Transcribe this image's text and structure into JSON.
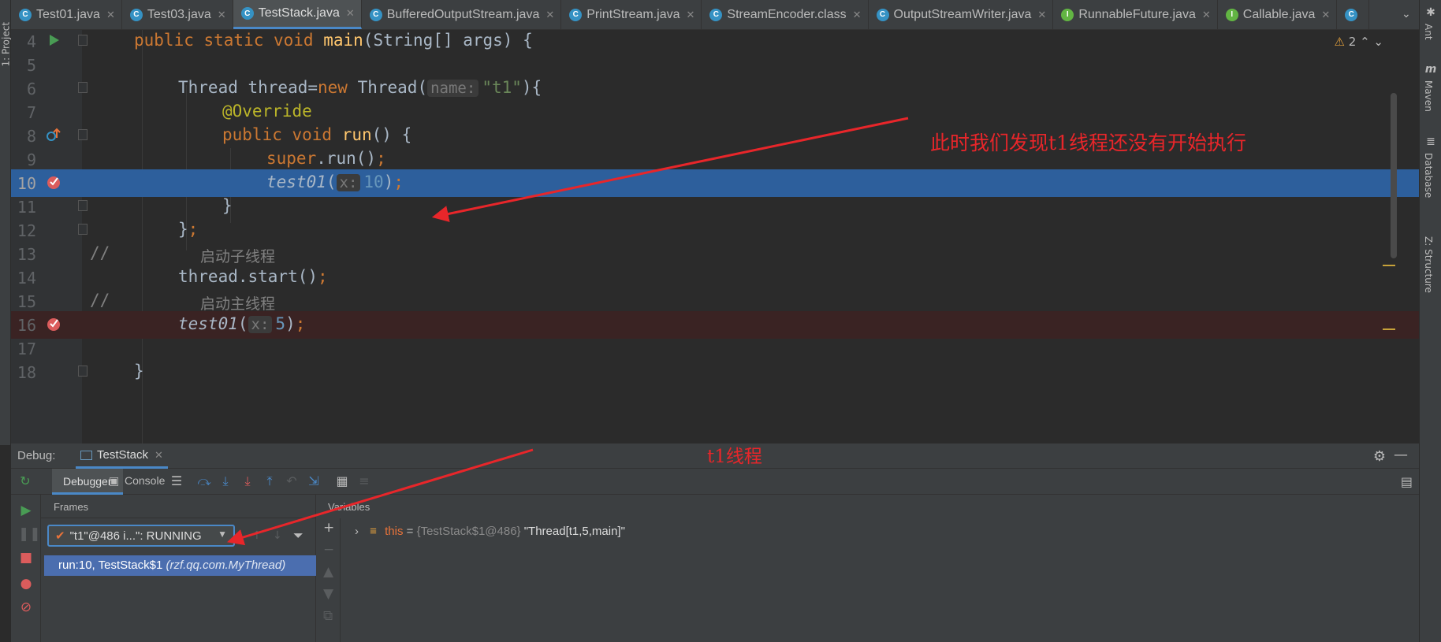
{
  "tabs": [
    {
      "label": "Test01.java",
      "icon": "class-icon",
      "active": false
    },
    {
      "label": "Test03.java",
      "icon": "class-icon",
      "active": false
    },
    {
      "label": "TestStack.java",
      "icon": "class-icon",
      "active": true
    },
    {
      "label": "BufferedOutputStream.java",
      "icon": "class-icon",
      "active": false
    },
    {
      "label": "PrintStream.java",
      "icon": "class-icon",
      "active": false
    },
    {
      "label": "StreamEncoder.class",
      "icon": "class-icon",
      "active": false
    },
    {
      "label": "OutputStreamWriter.java",
      "icon": "class-icon",
      "active": false
    },
    {
      "label": "RunnableFuture.java",
      "icon": "interface-icon",
      "active": false
    },
    {
      "label": "Callable.java",
      "icon": "interface-icon",
      "active": false
    }
  ],
  "left_strip": {
    "label": "1: Project"
  },
  "right_strip": {
    "ant": "Ant",
    "maven": "Maven",
    "database": "Database",
    "structure": "Z: Structure"
  },
  "editor": {
    "warnings": "2",
    "lines": {
      "l4": {
        "num": "4",
        "k1": "public static void ",
        "fn": "main",
        "rest": "(String[] args) {"
      },
      "l5": {
        "num": "5"
      },
      "l6": {
        "num": "6",
        "a": "Thread thread=",
        "kw": "new",
        "b": " Thread(",
        "hint": "name:",
        "str": "\"t1\"",
        "c": "){"
      },
      "l7": {
        "num": "7",
        "ann": "@Override"
      },
      "l8": {
        "num": "8",
        "kw": "public void ",
        "fn": "run",
        "rest": "() {"
      },
      "l9": {
        "num": "9",
        "kw": "super",
        "rest": ".run()",
        "semi": ";"
      },
      "l10": {
        "num": "10",
        "fn": "test01",
        "open": "(",
        "hint": "x:",
        "val": "10",
        "close": ")",
        "semi": ";"
      },
      "l11": {
        "num": "11",
        "text": "}"
      },
      "l12": {
        "num": "12",
        "text": "}",
        "semi": ";"
      },
      "l13": {
        "num": "13",
        "cmt": "//",
        "cjk": "启动子线程"
      },
      "l14": {
        "num": "14",
        "text": "thread.start()",
        "semi": ";"
      },
      "l15": {
        "num": "15",
        "cmt": "//",
        "cjk": "启动主线程"
      },
      "l16": {
        "num": "16",
        "fn": "test01",
        "open": "(",
        "hint": "x:",
        "val": "5",
        "close": ")",
        "semi": ";"
      },
      "l17": {
        "num": "17"
      },
      "l18": {
        "num": "18",
        "text": "}"
      }
    }
  },
  "annotations": {
    "top": "此时我们发现t1线程还没有开始执行",
    "bottom": "t1线程",
    "color": "#e8262a"
  },
  "debug": {
    "label": "Debug:",
    "session_tab": "TestStack",
    "tabs": {
      "debugger": "Debugger",
      "console": "Console"
    },
    "frames": {
      "title": "Frames",
      "thread": "\"t1\"@486 i...\": RUNNING",
      "frame_method": "run:10, TestStack$1",
      "frame_package": "(rzf.qq.com.MyThread)"
    },
    "variables": {
      "title": "Variables",
      "name": "this",
      "eq": " = ",
      "type": "{TestStack$1@486}",
      "value": " \"Thread[t1,5,main]\""
    }
  },
  "colors": {
    "accent": "#4a88c7",
    "exec_line": "#2d5f9c",
    "breakpoint_line": "#3a2323",
    "selected_frame": "#4b6eaf"
  }
}
